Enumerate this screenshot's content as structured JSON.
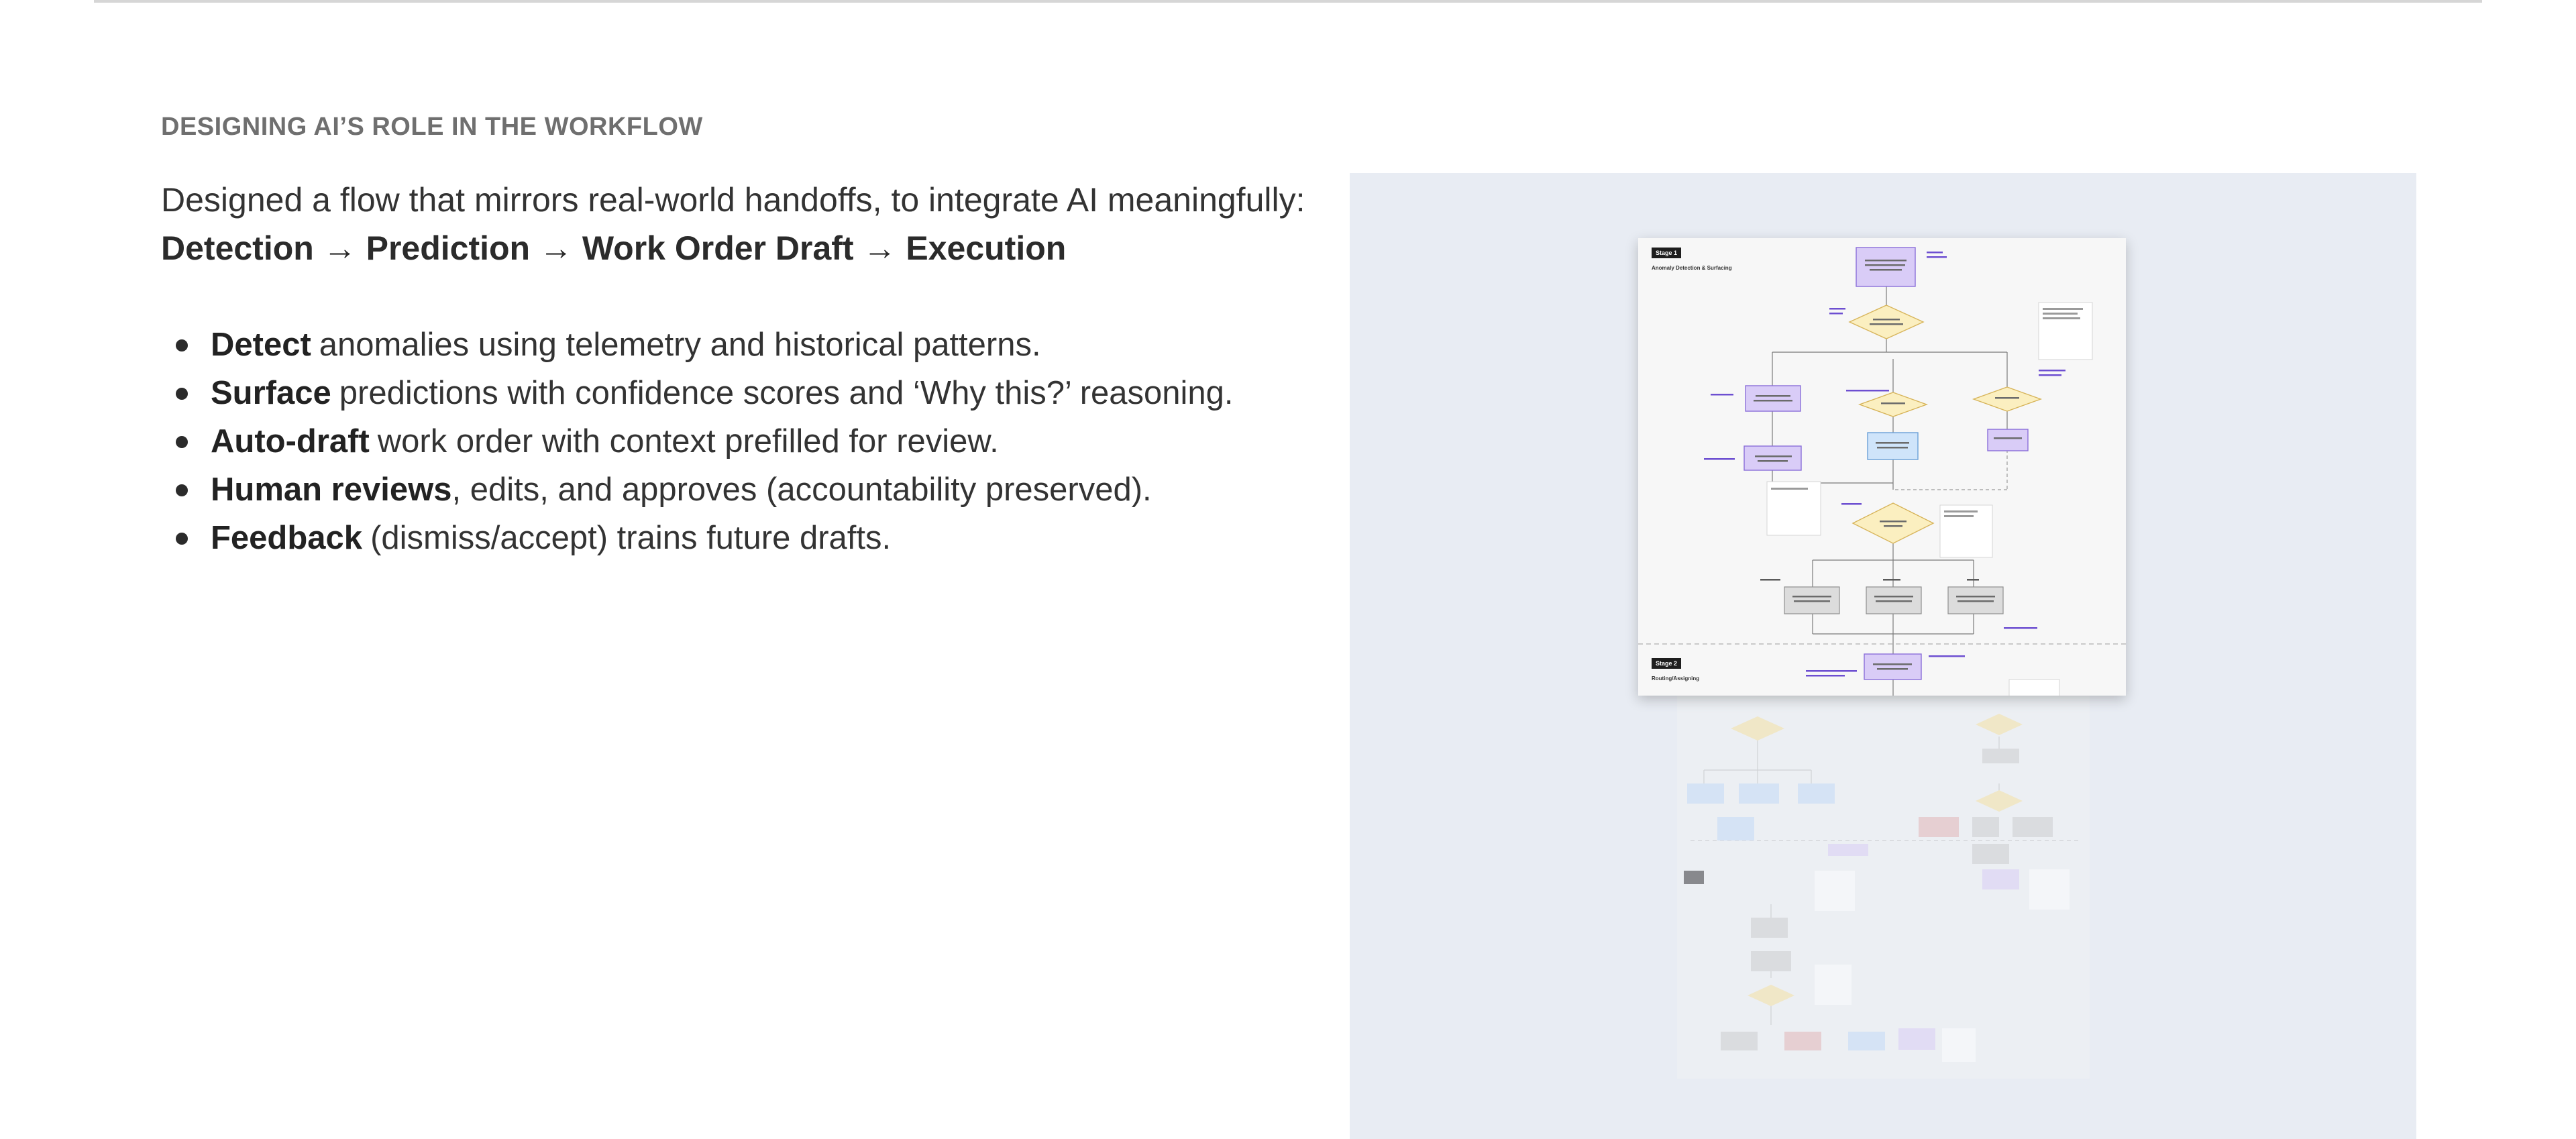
{
  "section": {
    "eyebrow": "DESIGNING AI’S ROLE IN THE WORKFLOW",
    "intro": "Designed a flow that mirrors real-world handoffs, to integrate AI meaningfully:",
    "flow": "Detection → Prediction → Work Order Draft → Execution"
  },
  "bullets": [
    {
      "bold": "Detect",
      "rest": "anomalies using telemetry and historical patterns."
    },
    {
      "bold": "Surface",
      "rest": "predictions with confidence scores and ‘Why this?’ reasoning."
    },
    {
      "bold": "Auto-draft",
      "rest": "work order with context prefilled for review."
    },
    {
      "bold": "Human reviews",
      "rest": ", edits, and approves (accountability preserved)."
    },
    {
      "bold": "Feedback",
      "rest": "(dismiss/accept) trains future drafts."
    }
  ],
  "diagram": {
    "stage1_tag": "Stage 1",
    "stage1_title": "Anomaly Detection & Surfacing",
    "stage2_tag": "Stage 2",
    "stage2_title": "Routing/Assigning",
    "colors": {
      "panel_bg": "#e8ecf3",
      "purple_node": "#d9ccf7",
      "purple_border": "#8b6fd9",
      "diamond": "#fbefc0",
      "diamond_border": "#d7b45a",
      "blue_node": "#cfe4fa",
      "grey_node": "#dcdcdc",
      "link_purple": "#6d4fd1"
    }
  }
}
